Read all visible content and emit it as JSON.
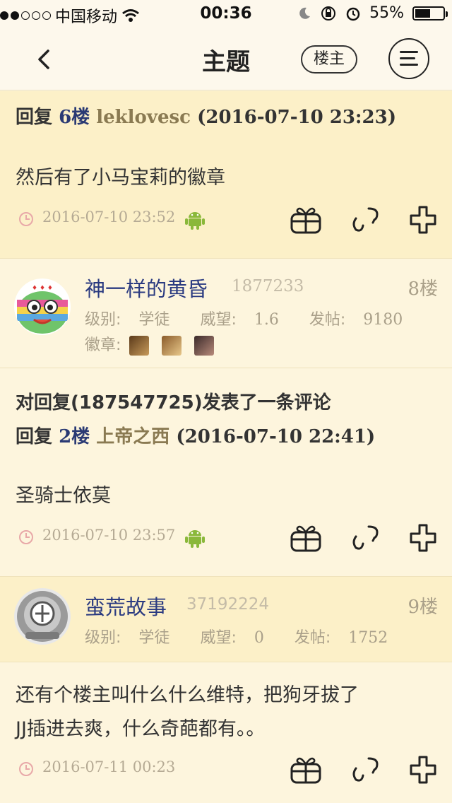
{
  "status_bar": {
    "carrier": "中国移动",
    "time": "00:36",
    "battery": "55%",
    "battery_level": 0.55
  },
  "nav": {
    "title": "主题",
    "owner_label": "楼主"
  },
  "posts": [
    {
      "reply_prefix": "回复",
      "reply_floor": "6楼",
      "reply_user": "leklovesc",
      "reply_time": "(2016-07-10 23:23)",
      "body": "然后有了小马宝莉的徽章",
      "timestamp": "2016-07-10 23:52",
      "platform_icon": "android-icon"
    },
    {
      "author": "神一样的黄昏",
      "uid": "1877233",
      "floor": "8楼",
      "level_label": "级别:",
      "level": "学徒",
      "prestige_label": "威望:",
      "prestige": "1.6",
      "posts_label": "发帖:",
      "posts_count": "9180",
      "badges_label": "徽章:",
      "comment_header": "对回复(187547725)发表了一条评论",
      "reply_prefix": "回复",
      "reply_floor": "2楼",
      "reply_user": "上帝之西",
      "reply_time": "(2016-07-10 22:41)",
      "body": "圣骑士依莫",
      "timestamp": "2016-07-10 23:57",
      "platform_icon": "android-icon"
    },
    {
      "author": "蛮荒故事",
      "uid": "37192224",
      "floor": "9楼",
      "level_label": "级别:",
      "level": "学徒",
      "prestige_label": "威望:",
      "prestige": "0",
      "posts_label": "发帖:",
      "posts_count": "1752",
      "body_line1": "还有个楼主叫什么什么维特，把狗牙拔了",
      "body_line2": "JJ插进去爽，什么奇葩都有。。",
      "timestamp": "2016-07-11 00:23"
    }
  ],
  "colors": {
    "background": "#fdf5dd",
    "reply_bg": "#fcf0c8",
    "username": "#2a3a80",
    "meta": "#b5aa94"
  }
}
